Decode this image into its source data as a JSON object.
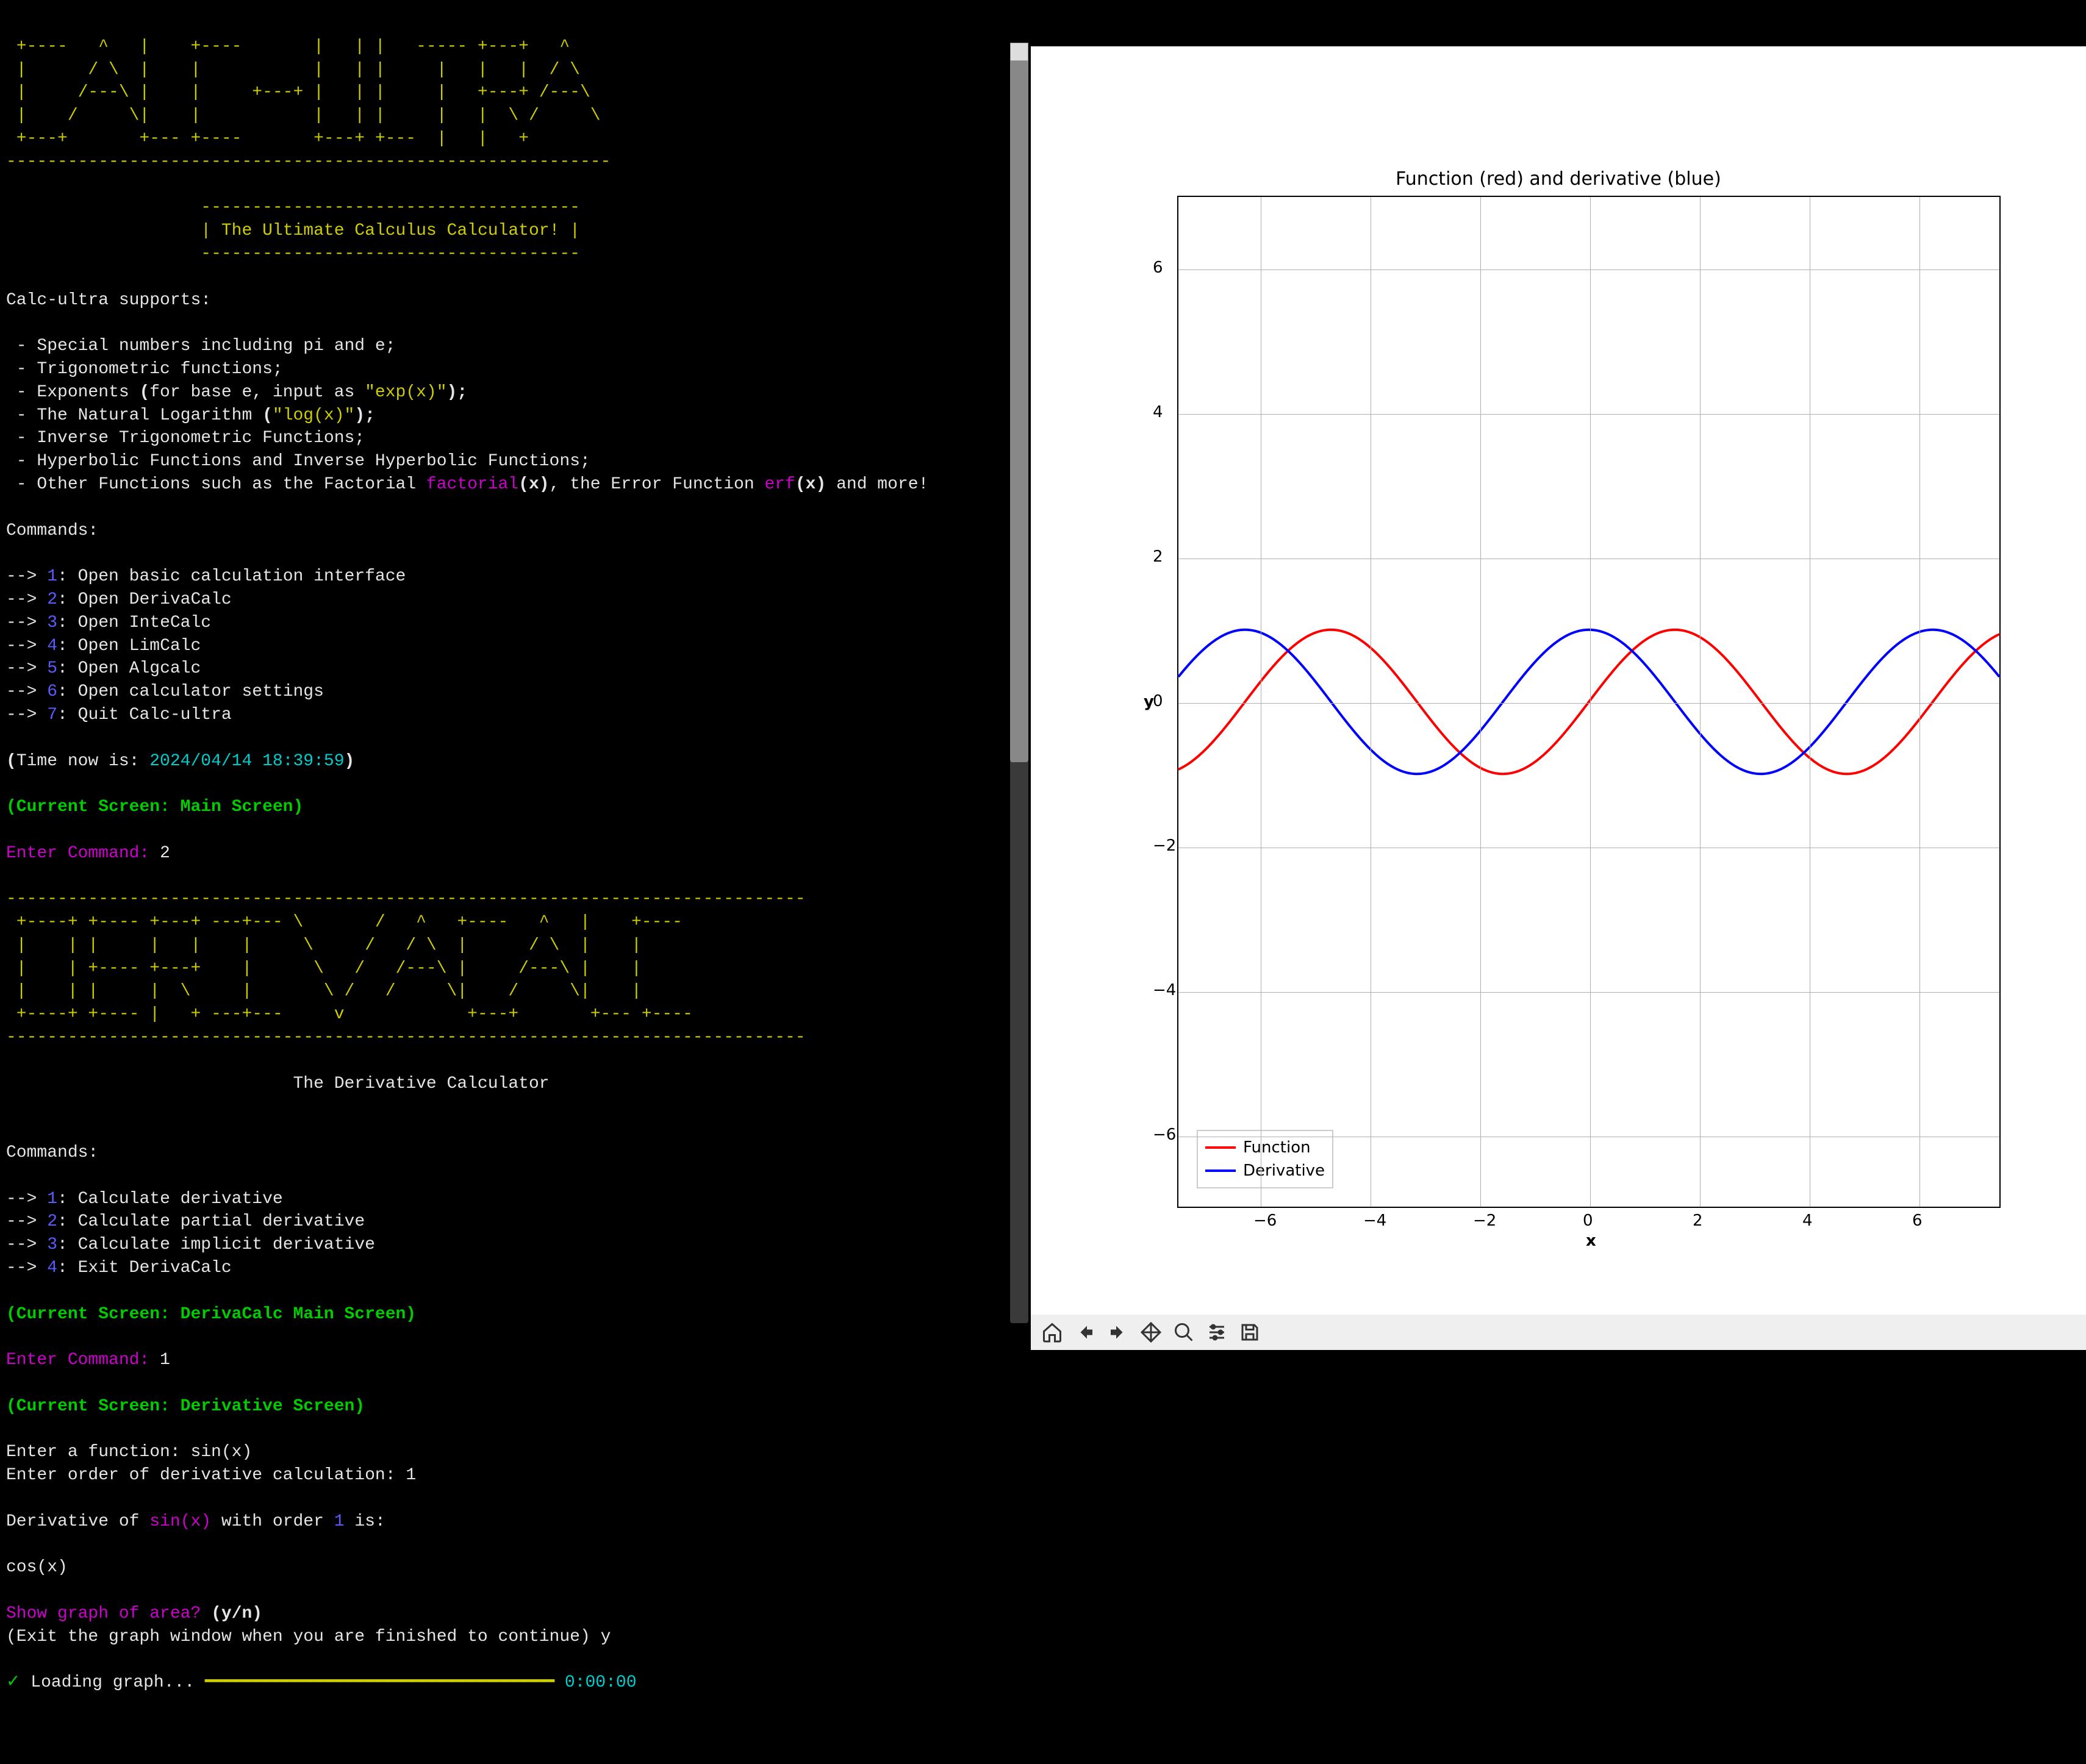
{
  "ascii": {
    "calc_ultra": " +----   ^   |    +----       |   | |   ----- +---+   ^  \n |      / \\  |    |           |   | |     |   |   |  / \\ \n |     /---\\ |    |     +---+ |   | |     |   +---+ /---\\\n |    /     \\|    |           |   | |     |   |  \\ /     \\\n +---+       +--- +----       +---+ +---  |   |   +       \n-----------------------------------------------------------",
    "tagline": "| The Ultimate Calculus Calculator! |",
    "tagline_border": "-------------------------------------",
    "derivacalc": "------------------------------------------------------------------------------\n +----+ +---- +---+ ---+--- \\       /   ^   +----   ^   |    +----\n |    | |     |   |    |     \\     /   / \\  |      / \\  |    |\n |    | +---- +---+    |      \\   /   /---\\ |     /---\\ |    |\n |    | |     |  \\     |       \\ /   /     \\|    /     \\|    |\n +----+ +---- |   + ---+---     v            +---+       +--- +----\n------------------------------------------------------------------------------",
    "derivacalc_subtitle": "The Derivative Calculator"
  },
  "intro": {
    "supports": "Calc-ultra supports:",
    "items": [
      " - Special numbers including pi and e;",
      " - Trigonometric functions;",
      " - Exponents ",
      " - The Natural Logarithm ",
      " - Inverse Trigonometric Functions;",
      " - Hyperbolic Functions and Inverse Hyperbolic Functions;",
      " - Other Functions such as the Factorial "
    ],
    "exp_pre": "(",
    "exp_mid1": "for base e, input as ",
    "exp_str": "\"exp(x)\"",
    "exp_post": ");",
    "log_pre": "(",
    "log_str": "\"log(x)\"",
    "log_post": ");",
    "factorial": "factorial",
    "factorial_post": "(x)",
    "erf_pre": ", the Error Function ",
    "erf": "erf",
    "erf_post": "(x)",
    "more": " and more!"
  },
  "commands": {
    "header": "Commands:",
    "arrow": "--> ",
    "main": [
      {
        "n": "1",
        "label": "Open basic calculation interface"
      },
      {
        "n": "2",
        "label": "Open DerivaCalc"
      },
      {
        "n": "3",
        "label": "Open InteCalc"
      },
      {
        "n": "4",
        "label": "Open LimCalc"
      },
      {
        "n": "5",
        "label": "Open Algcalc"
      },
      {
        "n": "6",
        "label": "Open calculator settings"
      },
      {
        "n": "7",
        "label": "Quit Calc-ultra"
      }
    ],
    "deriva": [
      {
        "n": "1",
        "label": "Calculate derivative"
      },
      {
        "n": "2",
        "label": "Calculate partial derivative"
      },
      {
        "n": "3",
        "label": "Calculate implicit derivative"
      },
      {
        "n": "4",
        "label": "Exit DerivaCalc"
      }
    ]
  },
  "time": {
    "prefix": "(",
    "label": "Time now is: ",
    "value": "2024/04/14 18:39:59",
    "suffix": ")"
  },
  "screens": {
    "main": "(Current Screen: Main Screen)",
    "deriv_main": "(Current Screen: DerivaCalc Main Screen)",
    "deriv": "(Current Screen: Derivative Screen)"
  },
  "prompts": {
    "enter_command": "Enter Command: ",
    "cmd1_response": "2",
    "cmd2_response": "1",
    "enter_function": "Enter a function: ",
    "function_input": "sin(x)",
    "enter_order": "Enter order of derivative calculation: ",
    "order_input": "1",
    "deriv_of_pre": "Derivative of ",
    "deriv_fn": "sin(x)",
    "deriv_with": " with order ",
    "deriv_order": "1",
    "deriv_is": " is:",
    "result": "cos(x)",
    "show_graph_q": "Show graph of area? ",
    "show_graph_opts": "(y/n)",
    "exit_note": "(Exit the graph window when you are finished to continue) ",
    "exit_response": "y",
    "loading_check": "✓",
    "loading_text": " Loading graph... ",
    "loading_bar": "━━━━━━━━━━━━━━━━━━━━━━━━━━━━━━━━━━",
    "loading_time": " 0:00:00"
  },
  "chart_data": {
    "type": "line",
    "title": "Function (red) and derivative (blue)",
    "xlabel": "x",
    "ylabel": "y",
    "xlim": [
      -7.5,
      7.5
    ],
    "ylim": [
      -7.0,
      7.0
    ],
    "xticks": [
      -6,
      -4,
      -2,
      0,
      2,
      4,
      6
    ],
    "yticks": [
      -6,
      -4,
      -2,
      0,
      2,
      4,
      6
    ],
    "series": [
      {
        "name": "Function",
        "color": "#ff0000",
        "formula": "sin(x)",
        "x": [
          -7.5,
          -7.0,
          -6.5,
          -6.0,
          -5.5,
          -5.0,
          -4.5,
          -4.0,
          -3.5,
          -3.0,
          -2.5,
          -2.0,
          -1.5,
          -1.0,
          -0.5,
          0.0,
          0.5,
          1.0,
          1.5,
          2.0,
          2.5,
          3.0,
          3.5,
          4.0,
          4.5,
          5.0,
          5.5,
          6.0,
          6.5,
          7.0,
          7.5
        ],
        "y": [
          -0.938,
          -0.657,
          -0.215,
          0.279,
          0.706,
          0.959,
          0.978,
          0.757,
          0.351,
          -0.141,
          -0.599,
          -0.909,
          -0.997,
          -0.841,
          -0.479,
          0.0,
          0.479,
          0.841,
          0.997,
          0.909,
          0.599,
          0.141,
          -0.351,
          -0.757,
          -0.978,
          -0.959,
          -0.706,
          -0.279,
          0.215,
          0.657,
          0.938
        ]
      },
      {
        "name": "Derivative",
        "color": "#0000ff",
        "formula": "cos(x)",
        "x": [
          -7.5,
          -7.0,
          -6.5,
          -6.0,
          -5.5,
          -5.0,
          -4.5,
          -4.0,
          -3.5,
          -3.0,
          -2.5,
          -2.0,
          -1.5,
          -1.0,
          -0.5,
          0.0,
          0.5,
          1.0,
          1.5,
          2.0,
          2.5,
          3.0,
          3.5,
          4.0,
          4.5,
          5.0,
          5.5,
          6.0,
          6.5,
          7.0,
          7.5
        ],
        "y": [
          0.347,
          0.754,
          0.977,
          0.96,
          0.709,
          0.284,
          -0.211,
          -0.654,
          -0.936,
          -0.99,
          -0.801,
          -0.416,
          0.071,
          0.54,
          0.878,
          1.0,
          0.878,
          0.54,
          0.071,
          -0.416,
          -0.801,
          -0.99,
          -0.936,
          -0.654,
          -0.211,
          0.284,
          0.709,
          0.96,
          0.977,
          0.754,
          0.347
        ]
      }
    ]
  },
  "toolbar": {
    "home": "Home",
    "back": "Back",
    "forward": "Forward",
    "pan": "Pan",
    "zoom": "Zoom",
    "configure": "Configure",
    "save": "Save"
  }
}
